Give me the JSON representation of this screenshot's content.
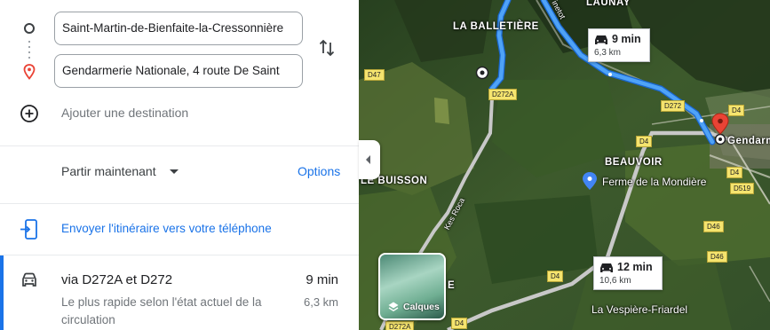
{
  "waypoints": {
    "origin": "Saint-Martin-de-Bienfaite-la-Cressonnière",
    "destination": "Gendarmerie Nationale, 4 route De Saint",
    "add_label": "Ajouter une destination"
  },
  "departure": {
    "label": "Partir maintenant",
    "options_label": "Options"
  },
  "send_to_phone": "Envoyer l'itinéraire vers votre téléphone",
  "route": {
    "via": "via D272A et D272",
    "time": "9 min",
    "description": "Le plus rapide selon l'état actuel de la circulation",
    "distance": "6,3 km"
  },
  "map": {
    "places": {
      "launay": "LAUNAY",
      "balletiere": "LA BALLETIÈRE",
      "beauvoir": "BEAUVOIR",
      "buisson": "LE BUISSON",
      "vespiere": "La Vespière-Friardel",
      "gendarmerie": "Gendarm",
      "poi": "Ferme de la Mondière",
      "road_text_1": "Kes Roca",
      "road_text_2": "inetot",
      "e_label": "E"
    },
    "roads": {
      "d47": "D47",
      "d272a": "D272A",
      "d272": "D272",
      "d4a": "D4",
      "d4b": "D4",
      "d4c": "D4",
      "d4d": "D4",
      "d4e": "D4",
      "d519": "D519",
      "d46a": "D46",
      "d46b": "D46",
      "d272a_bottom": "D272A"
    },
    "cards": {
      "primary_time": "9 min",
      "primary_dist": "6,3 km",
      "alt_time": "12 min",
      "alt_dist": "10,6 km"
    },
    "layers_label": "Calques",
    "colors": {
      "route_primary": "#4fa3f7",
      "route_alt": "#c8c8c8",
      "accent": "#1a73e8",
      "pin": "#ea4335"
    }
  }
}
